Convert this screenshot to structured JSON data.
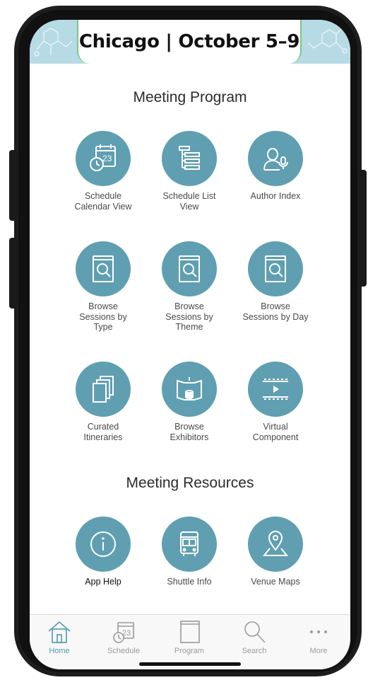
{
  "header": {
    "title": "Chicago | October 5–9"
  },
  "sections": {
    "program_title": "Meeting Program",
    "resources_title": "Meeting Resources"
  },
  "program_items": [
    {
      "label": "Schedule\nCalendar View",
      "icon": "calendar-clock-icon"
    },
    {
      "label": "Schedule List\nView",
      "icon": "list-tree-icon"
    },
    {
      "label": "Author Index",
      "icon": "person-mic-icon"
    },
    {
      "label": "Browse\nSessions by\nType",
      "icon": "book-magnifier-icon"
    },
    {
      "label": "Browse\nSessions by\nTheme",
      "icon": "book-magnifier-icon"
    },
    {
      "label": "Browse\nSessions by Day",
      "icon": "book-magnifier-icon"
    },
    {
      "label": "Curated\nItineraries",
      "icon": "stacked-pages-icon"
    },
    {
      "label": "Browse\nExhibitors",
      "icon": "exhibit-booth-icon"
    },
    {
      "label": "Virtual\nComponent",
      "icon": "film-play-icon"
    }
  ],
  "resource_items": [
    {
      "label": "App Help",
      "icon": "info-icon"
    },
    {
      "label": "Shuttle Info",
      "icon": "bus-icon"
    },
    {
      "label": "Venue Maps",
      "icon": "map-pin-icon"
    }
  ],
  "tabbar": [
    {
      "label": "Home",
      "icon": "home-icon",
      "active": true
    },
    {
      "label": "Schedule",
      "icon": "calendar-icon",
      "active": false
    },
    {
      "label": "Program",
      "icon": "book-icon",
      "active": false
    },
    {
      "label": "Search",
      "icon": "search-icon",
      "active": false
    },
    {
      "label": "More",
      "icon": "more-dots-icon",
      "active": false
    }
  ],
  "colors": {
    "accent": "#5f9fb1",
    "banner": "#b7dbe4",
    "banner_border": "#7dc48a",
    "active_tab": "#4f9bb1"
  }
}
